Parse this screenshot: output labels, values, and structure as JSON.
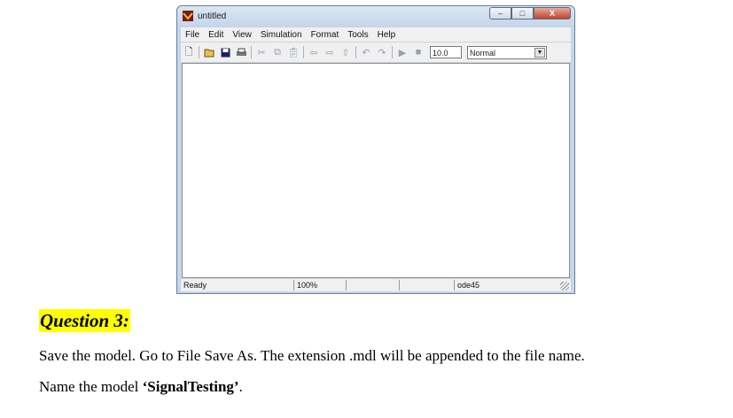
{
  "window": {
    "title": "untitled",
    "controls": {
      "minimize": "–",
      "maximize": "□",
      "close": "X"
    }
  },
  "menu": [
    "File",
    "Edit",
    "View",
    "Simulation",
    "Format",
    "Tools",
    "Help"
  ],
  "toolbar": {
    "icons": [
      "new-icon",
      "open-icon",
      "save-icon",
      "print-icon",
      "cut-icon",
      "copy-icon",
      "paste-icon",
      "back-icon",
      "forward-icon",
      "up-icon",
      "undo-icon",
      "redo-icon",
      "play-icon",
      "stop-icon"
    ],
    "stop_time": "10.0",
    "sim_mode": "Normal"
  },
  "status": {
    "state": "Ready",
    "zoom": "100%",
    "solver": "ode45"
  },
  "document": {
    "question_heading": "Question 3:",
    "line1": "Save the model. Go to File  Save As. The extension .mdl will be appended to the file name.",
    "line2_prefix": "Name the model ",
    "model_name": "‘SignalTesting’",
    "line2_suffix": "."
  }
}
